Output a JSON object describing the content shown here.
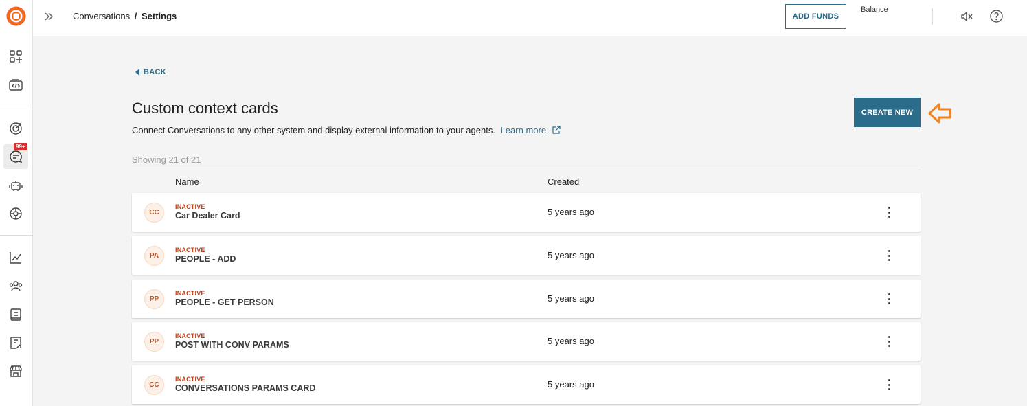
{
  "breadcrumb": {
    "parent": "Conversations",
    "separator": "/",
    "current": "Settings"
  },
  "header": {
    "add_funds_label": "ADD FUNDS",
    "balance_label": "Balance"
  },
  "sidebar": {
    "badge": "99+"
  },
  "page": {
    "back_label": "BACK",
    "title": "Custom context cards",
    "description": "Connect Conversations to any other system and display external information to your agents.",
    "learn_more": "Learn more",
    "create_new_label": "CREATE NEW",
    "showing": "Showing 21 of 21"
  },
  "table": {
    "columns": {
      "name": "Name",
      "created": "Created"
    },
    "rows": [
      {
        "initials": "CC",
        "status": "INACTIVE",
        "name": "Car Dealer Card",
        "created": "5 years ago"
      },
      {
        "initials": "PA",
        "status": "INACTIVE",
        "name": "PEOPLE - ADD",
        "created": "5 years ago"
      },
      {
        "initials": "PP",
        "status": "INACTIVE",
        "name": "PEOPLE - GET PERSON",
        "created": "5 years ago"
      },
      {
        "initials": "PP",
        "status": "INACTIVE",
        "name": "POST WITH CONV PARAMS",
        "created": "5 years ago"
      },
      {
        "initials": "CC",
        "status": "INACTIVE",
        "name": "CONVERSATIONS PARAMS CARD",
        "created": "5 years ago"
      }
    ]
  },
  "colors": {
    "accent": "#2b6c8a",
    "brand": "#f26522",
    "inactive": "#c0401d",
    "hint_arrow": "#f58220"
  }
}
